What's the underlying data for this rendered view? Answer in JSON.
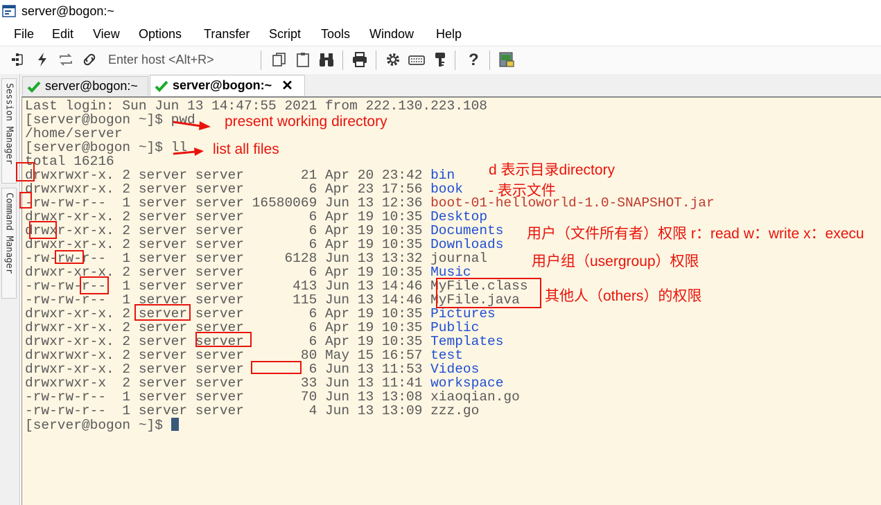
{
  "window": {
    "title": "server@bogon:~"
  },
  "menu": [
    "File",
    "Edit",
    "View",
    "Options",
    "Transfer",
    "Script",
    "Tools",
    "Window",
    "Help"
  ],
  "toolbar": {
    "host_placeholder": "Enter host <Alt+R>"
  },
  "side_panel": {
    "session_manager": "Session Manager",
    "command_manager": "Command Manager"
  },
  "tabs": [
    {
      "label": "server@bogon:~",
      "active": false
    },
    {
      "label": "server@bogon:~",
      "active": true,
      "close": "✕"
    }
  ],
  "terminal": {
    "last_login": "Last login: Sun Jun 13 14:47:55 2021 from 222.130.223.108",
    "cmd_pwd": "[server@bogon ~]$ pwd",
    "pwd_output": "/home/server",
    "cmd_ll": "[server@bogon ~]$ ll",
    "total": "total 16216",
    "files": [
      {
        "perm": "drwxrwxr-x.",
        "meta": " 2 server server       21 Apr 20 23:42 ",
        "name": "bin",
        "color": "blue"
      },
      {
        "perm": "drwxrwxr-x.",
        "meta": " 2 server server        6 Apr 23 17:56 ",
        "name": "book",
        "color": "blue"
      },
      {
        "perm": "-rw-rw-r--",
        "meta": "  1 server server 16580069 Jun 13 12:36 ",
        "name": "boot-01-helloworld-1.0-SNAPSHOT.jar",
        "color": "red"
      },
      {
        "perm": "drwxr-xr-x.",
        "meta": " 2 server server        6 Apr 19 10:35 ",
        "name": "Desktop",
        "color": "blue"
      },
      {
        "perm": "drwxr-xr-x.",
        "meta": " 2 server server        6 Apr 19 10:35 ",
        "name": "Documents",
        "color": "blue"
      },
      {
        "perm": "drwxr-xr-x.",
        "meta": " 2 server server        6 Apr 19 10:35 ",
        "name": "Downloads",
        "color": "blue"
      },
      {
        "perm": "-rw-rw-r--",
        "meta": "  1 server server     6128 Jun 13 13:32 ",
        "name": "journal",
        "color": "plain"
      },
      {
        "perm": "drwxr-xr-x.",
        "meta": " 2 server server        6 Apr 19 10:35 ",
        "name": "Music",
        "color": "blue"
      },
      {
        "perm": "-rw-rw-r--",
        "meta": "  1 server server      413 Jun 13 14:46 ",
        "name": "MyFile.class",
        "color": "plain"
      },
      {
        "perm": "-rw-rw-r--",
        "meta": "  1 server server      115 Jun 13 14:46 ",
        "name": "MyFile.java",
        "color": "plain"
      },
      {
        "perm": "drwxr-xr-x.",
        "meta": " 2 server server        6 Apr 19 10:35 ",
        "name": "Pictures",
        "color": "blue"
      },
      {
        "perm": "drwxr-xr-x.",
        "meta": " 2 server server        6 Apr 19 10:35 ",
        "name": "Public",
        "color": "blue"
      },
      {
        "perm": "drwxr-xr-x.",
        "meta": " 2 server server        6 Apr 19 10:35 ",
        "name": "Templates",
        "color": "blue"
      },
      {
        "perm": "drwxrwxr-x.",
        "meta": " 2 server server       80 May 15 16:57 ",
        "name": "test",
        "color": "blue"
      },
      {
        "perm": "drwxr-xr-x.",
        "meta": " 2 server server        6 Jun 13 11:53 ",
        "name": "Videos",
        "color": "blue"
      },
      {
        "perm": "drwxrwxr-x",
        "meta": "  2 server server       33 Jun 13 11:41 ",
        "name": "workspace",
        "color": "blue"
      },
      {
        "perm": "-rw-rw-r--",
        "meta": "  1 server server       70 Jun 13 13:08 ",
        "name": "xiaoqian.go",
        "color": "plain"
      },
      {
        "perm": "-rw-rw-r--",
        "meta": "  1 server server        4 Jun 13 13:09 ",
        "name": "zzz.go",
        "color": "plain"
      }
    ],
    "prompt": "[server@bogon ~]$ "
  },
  "annotations": {
    "pwd": "present working directory",
    "ll": "list all files",
    "dir": "d 表示目录directory",
    "file": "- 表示文件",
    "user": "用户（文件所有者）权限 r：read w：write x：execu",
    "group": "用户组（usergroup）权限",
    "others": "其他人（others）的权限",
    "color": "#e8140c"
  },
  "colors": {
    "terminal_bg": "#fdf6e3",
    "dir_blue": "#1f4fd3",
    "jar_red": "#c0392b"
  }
}
